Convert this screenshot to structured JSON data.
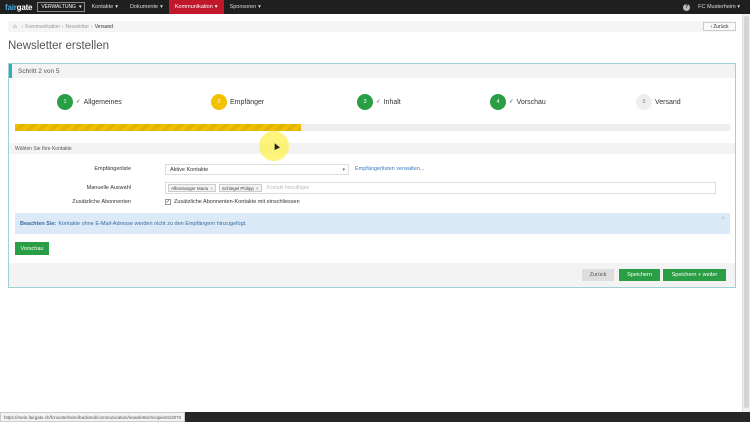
{
  "nav": {
    "logo_a": "fair",
    "logo_b": "gate",
    "org": "VERWALTUNG",
    "items": [
      {
        "label": "Kontakte"
      },
      {
        "label": "Dokumente"
      },
      {
        "label": "Kommunikation"
      },
      {
        "label": "Sponsoren"
      }
    ],
    "help": "?",
    "user": "FC Musterheim"
  },
  "breadcrumb": {
    "items": [
      "Kommunikation",
      "Newsletter",
      "Versand"
    ]
  },
  "back_label": "Zurück",
  "page_title": "Newsletter erstellen",
  "wizard": {
    "step_header": "Schritt 2 von 5",
    "steps": [
      {
        "num": "1",
        "label": "Allgemeines",
        "state": "done"
      },
      {
        "num": "2",
        "label": "Empfänger",
        "state": "current"
      },
      {
        "num": "3",
        "label": "Inhalt",
        "state": "done"
      },
      {
        "num": "4",
        "label": "Vorschau",
        "state": "done"
      },
      {
        "num": "5",
        "label": "Versand",
        "state": "todo"
      }
    ],
    "progress_fraction": 0.4
  },
  "section_title": "Wählen Sie Ihre Kontakte",
  "form": {
    "recipient_list_label": "Empfängerliste",
    "recipient_list_value": "Aktive Kontakte",
    "manage_lists_link": "Empfängerlisten verwalten...",
    "manual_label": "Manuelle Auswahl",
    "tags": [
      "Affentranger Maria",
      "Schlegel Philipp"
    ],
    "tag_input_placeholder": "Kontakt hinzufügen",
    "subscribers_label": "Zusätzliche Abonnenten",
    "subscribers_checkbox_label": "Zusätzliche Abonnenten-Kontakte mit einschliessen"
  },
  "alert": {
    "bold": "Beachten Sie:",
    "text": "Kontakte ohne E-Mail-Adresse werden nicht zu den Empfängern hinzugefügt."
  },
  "preview_button": "Vorschau",
  "footer": {
    "back": "Zurück",
    "save": "Speichern",
    "save_next": "Speichern + weiter"
  },
  "status_url": "https://mein.fairgate.ch/fcmusterheim/backend/communication/newsletter/recipients/3070",
  "colors": {
    "green": "#2a9e44",
    "yellow": "#f2c200",
    "nav_active": "#c0172b",
    "accent": "#2eaeb5"
  }
}
